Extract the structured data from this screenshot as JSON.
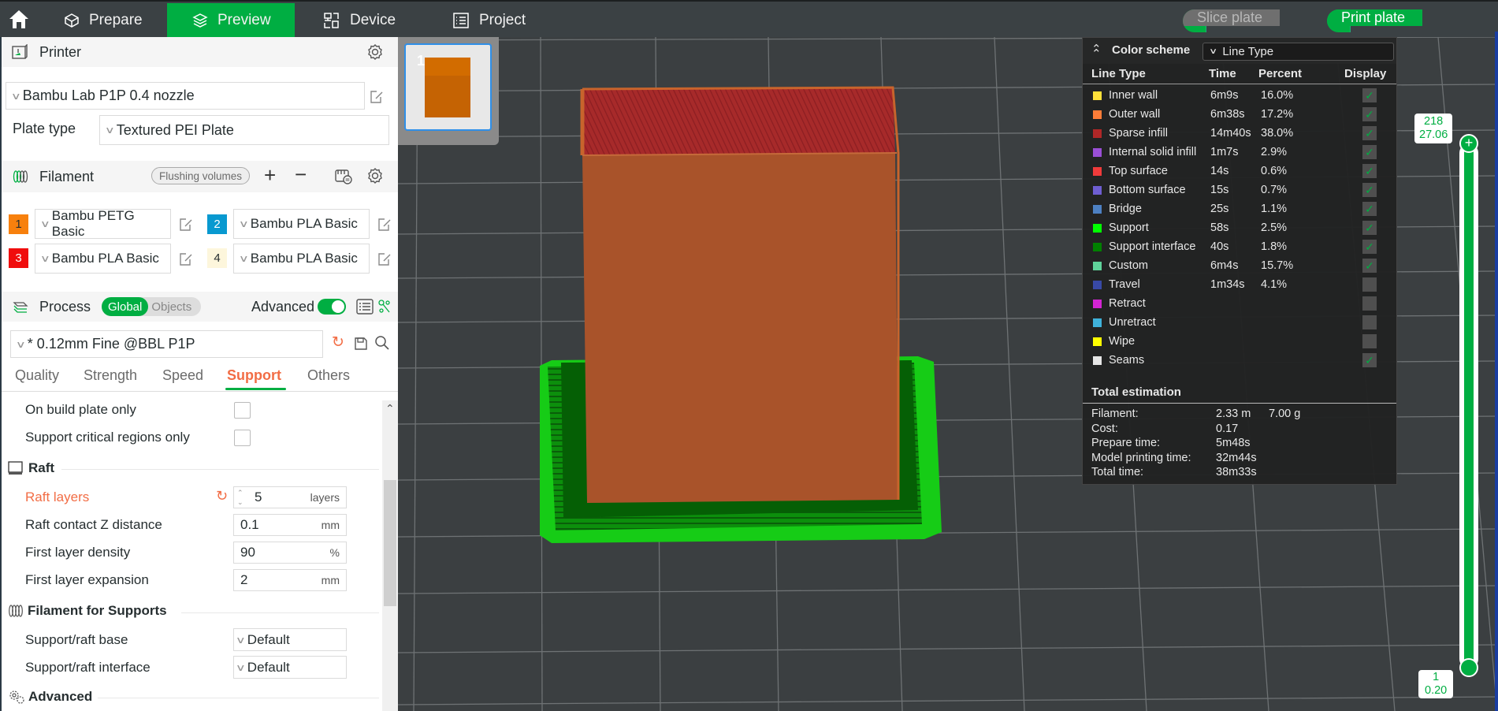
{
  "topbar": {
    "tabs": [
      {
        "label": "Prepare",
        "icon": "cube-icon",
        "active": false
      },
      {
        "label": "Preview",
        "icon": "layers-icon",
        "active": true
      },
      {
        "label": "Device",
        "icon": "device-icon",
        "active": false
      },
      {
        "label": "Project",
        "icon": "list-icon",
        "active": false
      }
    ],
    "slice_label": "Slice plate",
    "print_label": "Print plate",
    "accent": "#00ae42"
  },
  "printer": {
    "title": "Printer",
    "selected": "Bambu Lab P1P 0.4 nozzle",
    "plate_type_label": "Plate type",
    "plate_type": "Textured PEI Plate"
  },
  "filament": {
    "title": "Filament",
    "flushing_label": "Flushing volumes",
    "slots": [
      {
        "num": "1",
        "color": "#f7800d",
        "text_color": "#262e30",
        "name": "Bambu PETG Basic"
      },
      {
        "num": "2",
        "color": "#0899d0",
        "text_color": "#ffffff",
        "name": "Bambu PLA Basic"
      },
      {
        "num": "3",
        "color": "#f00d0d",
        "text_color": "#ffffff",
        "name": "Bambu PLA Basic"
      },
      {
        "num": "4",
        "color": "#fdf6dc",
        "text_color": "#262e30",
        "name": "Bambu PLA Basic"
      }
    ]
  },
  "process": {
    "title": "Process",
    "toggle_global": "Global",
    "toggle_objects": "Objects",
    "advanced_label": "Advanced",
    "advanced_on": true,
    "preset": "* 0.12mm Fine @BBL P1P",
    "tabs": [
      "Quality",
      "Strength",
      "Speed",
      "Support",
      "Others"
    ],
    "active_tab": "Support",
    "settings": {
      "on_build_plate_only": {
        "label": "On build plate only",
        "checked": false
      },
      "support_critical": {
        "label": "Support critical regions only",
        "checked": false
      },
      "raft_group": "Raft",
      "raft_layers": {
        "label": "Raft layers",
        "value": "5",
        "unit": "layers"
      },
      "raft_contact_z": {
        "label": "Raft contact Z distance",
        "value": "0.1",
        "unit": "mm"
      },
      "first_layer_density": {
        "label": "First layer density",
        "value": "90",
        "unit": "%"
      },
      "first_layer_expansion": {
        "label": "First layer expansion",
        "value": "2",
        "unit": "mm"
      },
      "filament_supports_group": "Filament for Supports",
      "support_base": {
        "label": "Support/raft base",
        "value": "Default"
      },
      "support_interface": {
        "label": "Support/raft interface",
        "value": "Default"
      },
      "advanced_group": "Advanced"
    }
  },
  "plate_thumb": {
    "number": "1"
  },
  "legend": {
    "title": "Color scheme",
    "scheme": "Line Type",
    "headers": {
      "type": "Line Type",
      "time": "Time",
      "percent": "Percent",
      "display": "Display"
    },
    "rows": [
      {
        "name": "Inner wall",
        "color": "#ffe13a",
        "time": "6m9s",
        "percent": "16.0%",
        "display": true
      },
      {
        "name": "Outer wall",
        "color": "#ff7d38",
        "time": "6m38s",
        "percent": "17.2%",
        "display": true
      },
      {
        "name": "Sparse infill",
        "color": "#b02727",
        "time": "14m40s",
        "percent": "38.0%",
        "display": true
      },
      {
        "name": "Internal solid infill",
        "color": "#9a4fd6",
        "time": "1m7s",
        "percent": "2.9%",
        "display": true
      },
      {
        "name": "Top surface",
        "color": "#f03b3b",
        "time": "14s",
        "percent": "0.6%",
        "display": true
      },
      {
        "name": "Bottom surface",
        "color": "#6e5ed1",
        "time": "15s",
        "percent": "0.7%",
        "display": true
      },
      {
        "name": "Bridge",
        "color": "#4d80c2",
        "time": "25s",
        "percent": "1.1%",
        "display": true
      },
      {
        "name": "Support",
        "color": "#00ff00",
        "time": "58s",
        "percent": "2.5%",
        "display": true
      },
      {
        "name": "Support interface",
        "color": "#008000",
        "time": "40s",
        "percent": "1.8%",
        "display": true
      },
      {
        "name": "Custom",
        "color": "#5fd39a",
        "time": "6m4s",
        "percent": "15.7%",
        "display": true
      },
      {
        "name": "Travel",
        "color": "#3849a6",
        "time": "1m34s",
        "percent": "4.1%",
        "display": false
      },
      {
        "name": "Retract",
        "color": "#d424d4",
        "time": "",
        "percent": "",
        "display": false
      },
      {
        "name": "Unretract",
        "color": "#3fb2db",
        "time": "",
        "percent": "",
        "display": false
      },
      {
        "name": "Wipe",
        "color": "#ffff00",
        "time": "",
        "percent": "",
        "display": false
      },
      {
        "name": "Seams",
        "color": "#e6e6e6",
        "time": "",
        "percent": "",
        "display": true
      }
    ],
    "total_title": "Total estimation",
    "totals": [
      {
        "label": "Filament:",
        "value": "2.33 m",
        "value2": "7.00 g"
      },
      {
        "label": "Cost:",
        "value": "0.17",
        "value2": ""
      },
      {
        "label": "Prepare time:",
        "value": "5m48s",
        "value2": ""
      },
      {
        "label": "Model printing time:",
        "value": "32m44s",
        "value2": ""
      },
      {
        "label": "Total time:",
        "value": "38m33s",
        "value2": ""
      }
    ]
  },
  "layer_slider": {
    "top_layer": "218",
    "top_height": "27.06",
    "bottom_layer": "1",
    "bottom_height": "0.20"
  }
}
